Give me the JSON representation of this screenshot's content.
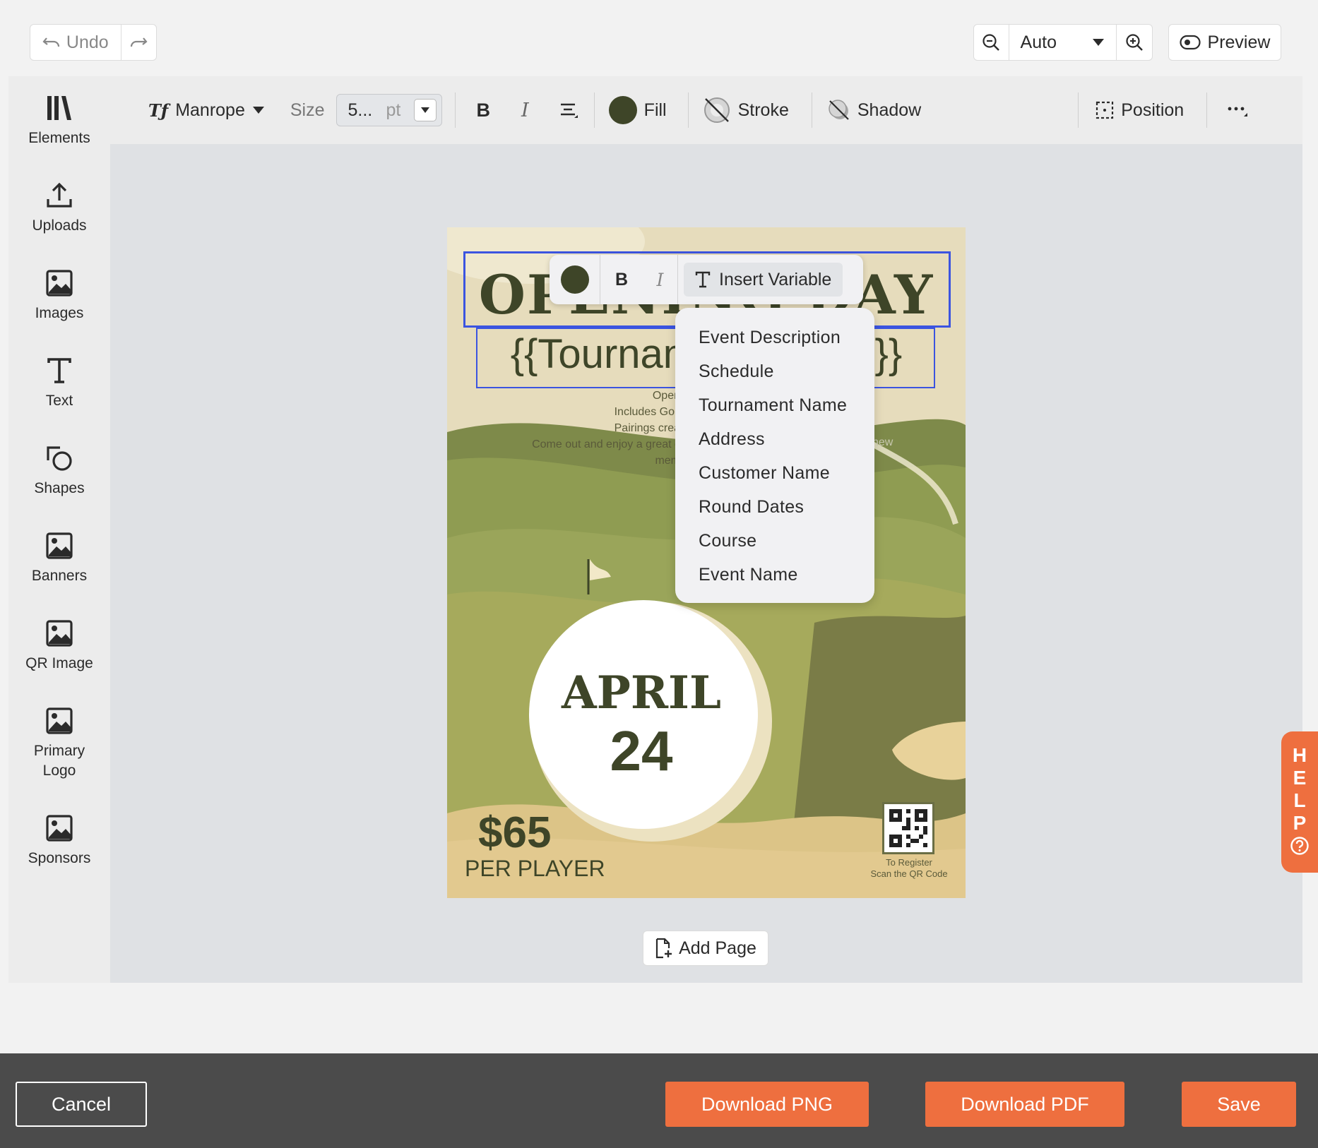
{
  "top_bar": {
    "undo_label": "Undo",
    "zoom_value": "Auto",
    "preview_label": "Preview"
  },
  "sidebar": {
    "items": [
      {
        "label": "Elements",
        "icon": "elements-icon"
      },
      {
        "label": "Uploads",
        "icon": "upload-icon"
      },
      {
        "label": "Images",
        "icon": "image-icon"
      },
      {
        "label": "Text",
        "icon": "text-icon"
      },
      {
        "label": "Shapes",
        "icon": "shapes-icon"
      },
      {
        "label": "Banners",
        "icon": "image-icon"
      },
      {
        "label": "QR Image",
        "icon": "image-icon"
      },
      {
        "label": "Primary Logo",
        "icon": "image-icon"
      },
      {
        "label": "Sponsors",
        "icon": "image-icon"
      }
    ]
  },
  "toolbar": {
    "font_name": "Manrope",
    "size_label": "Size",
    "size_value": "5...",
    "size_unit": "pt",
    "fill_label": "Fill",
    "fill_color": "#3e4528",
    "stroke_label": "Stroke",
    "shadow_label": "Shadow",
    "position_label": "Position"
  },
  "poster": {
    "title_text": "OPENING DAY",
    "subtitle_variable": "{{Tournament Name}}",
    "body_lines": [
      "Open",
      "Includes Golf",
      "Pairings crea",
      "Come out and enjoy a great c",
      "mem"
    ],
    "body_fragment_right": "new",
    "date_month": "APRIL",
    "date_day": "24",
    "price": "$65",
    "price_sub": "PER PLAYER",
    "qr_caption_line1": "To Register",
    "qr_caption_line2": "Scan the QR Code",
    "colors": {
      "dark_olive": "#3e4528",
      "sand": "#e6dcbc",
      "green": "#8a9a4a"
    }
  },
  "text_toolbar": {
    "insert_variable_label": "Insert Variable"
  },
  "variable_menu": {
    "items": [
      "Event Description",
      "Schedule",
      "Tournament Name",
      "Address",
      "Customer Name",
      "Round Dates",
      "Course",
      "Event Name"
    ]
  },
  "add_page_label": "Add Page",
  "help_letters": [
    "H",
    "E",
    "L",
    "P"
  ],
  "footer": {
    "cancel_label": "Cancel",
    "download_png_label": "Download PNG",
    "download_pdf_label": "Download PDF",
    "save_label": "Save",
    "accent_color": "#ee6f3f"
  }
}
